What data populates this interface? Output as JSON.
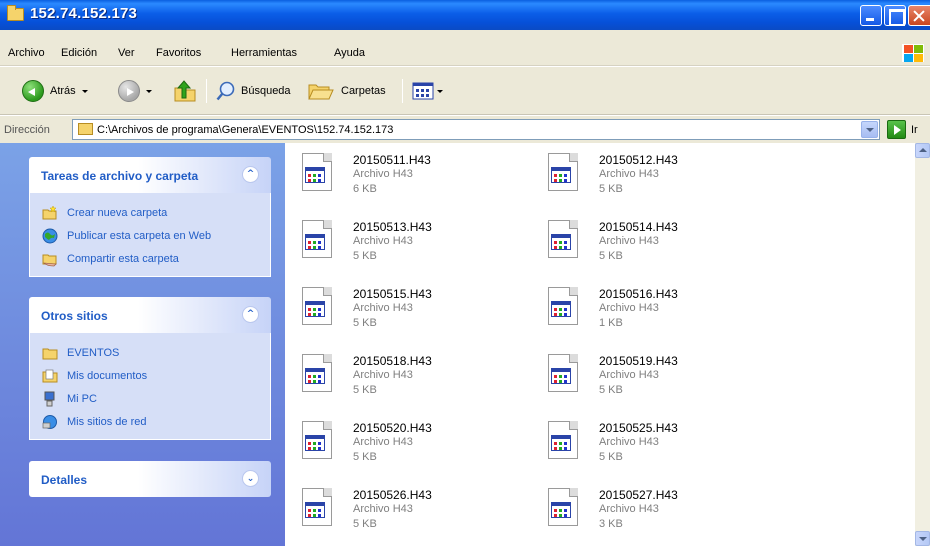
{
  "window": {
    "title": "152.74.152.173"
  },
  "menu": [
    "Archivo",
    "Edición",
    "Ver",
    "Favoritos",
    "Herramientas",
    "Ayuda"
  ],
  "toolbar": {
    "back_label": "Atrás",
    "search_label": "Búsqueda",
    "folders_label": "Carpetas"
  },
  "address": {
    "label": "Dirección",
    "path": "C:\\Archivos de programa\\Genera\\EVENTOS\\152.74.152.173",
    "go_label": "Ir"
  },
  "sidebar": {
    "tasks": {
      "title": "Tareas de archivo y carpeta",
      "items": [
        {
          "label": "Crear nueva carpeta",
          "icon": "new-folder-icon"
        },
        {
          "label": "Publicar esta carpeta en Web",
          "icon": "globe-icon"
        },
        {
          "label": "Compartir esta carpeta",
          "icon": "share-folder-icon"
        }
      ]
    },
    "places": {
      "title": "Otros sitios",
      "items": [
        {
          "label": "EVENTOS",
          "icon": "folder-icon"
        },
        {
          "label": "Mis documentos",
          "icon": "my-documents-icon"
        },
        {
          "label": "Mi PC",
          "icon": "my-computer-icon"
        },
        {
          "label": "Mis sitios de red",
          "icon": "network-icon"
        }
      ]
    },
    "details": {
      "title": "Detalles"
    }
  },
  "files": [
    {
      "name": "20150511.H43",
      "type": "Archivo H43",
      "size": "6 KB"
    },
    {
      "name": "20150512.H43",
      "type": "Archivo H43",
      "size": "5 KB"
    },
    {
      "name": "20150513.H43",
      "type": "Archivo H43",
      "size": "5 KB"
    },
    {
      "name": "20150514.H43",
      "type": "Archivo H43",
      "size": "5 KB"
    },
    {
      "name": "20150515.H43",
      "type": "Archivo H43",
      "size": "5 KB"
    },
    {
      "name": "20150516.H43",
      "type": "Archivo H43",
      "size": "1 KB"
    },
    {
      "name": "20150518.H43",
      "type": "Archivo H43",
      "size": "5 KB"
    },
    {
      "name": "20150519.H43",
      "type": "Archivo H43",
      "size": "5 KB"
    },
    {
      "name": "20150520.H43",
      "type": "Archivo H43",
      "size": "5 KB"
    },
    {
      "name": "20150525.H43",
      "type": "Archivo H43",
      "size": "5 KB"
    },
    {
      "name": "20150526.H43",
      "type": "Archivo H43",
      "size": "5 KB"
    },
    {
      "name": "20150527.H43",
      "type": "Archivo H43",
      "size": "3 KB"
    }
  ]
}
